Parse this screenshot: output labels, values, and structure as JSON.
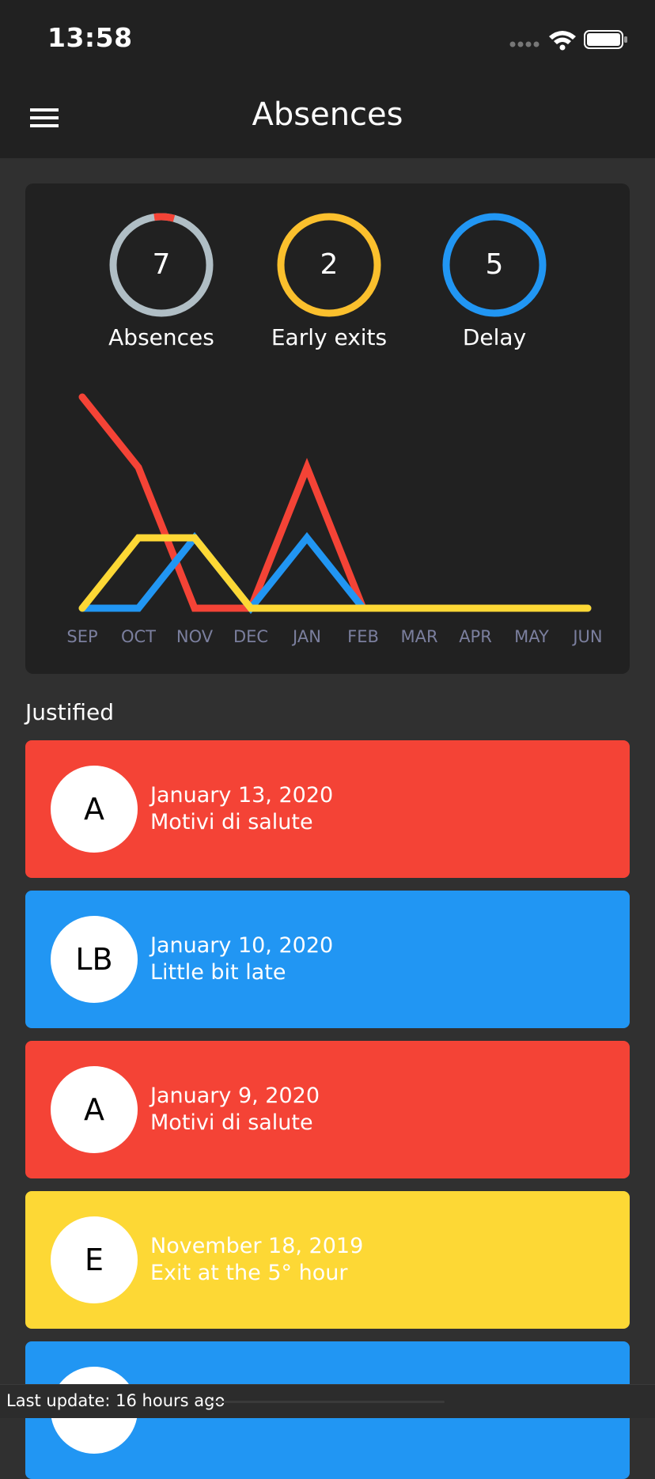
{
  "status_bar": {
    "time": "13:58"
  },
  "app_bar": {
    "title": "Absences"
  },
  "summary": {
    "absences": {
      "count": "7",
      "label": "Absences",
      "color": "#b0bec5",
      "accent": "#f44336"
    },
    "early_exits": {
      "count": "2",
      "label": "Early exits",
      "color": "#fbc02d"
    },
    "delay": {
      "count": "5",
      "label": "Delay",
      "color": "#2196f3"
    }
  },
  "chart_data": {
    "type": "line",
    "categories": [
      "SEP",
      "OCT",
      "NOV",
      "DEC",
      "JAN",
      "FEB",
      "MAR",
      "APR",
      "MAY",
      "JUN"
    ],
    "series": [
      {
        "color": "#f44336",
        "values": [
          3,
          2,
          0,
          0,
          2,
          0,
          0,
          0,
          0,
          0
        ]
      },
      {
        "color": "#2196f3",
        "values": [
          0,
          0,
          1,
          0,
          1,
          0,
          0,
          0,
          0,
          0
        ]
      },
      {
        "color": "#fdd835",
        "values": [
          0,
          1,
          1,
          0,
          0,
          0,
          0,
          0,
          0,
          0
        ]
      }
    ],
    "ylim": [
      0,
      3
    ]
  },
  "section": {
    "title": "Justified"
  },
  "items": [
    {
      "initials": "A",
      "date": "January 13, 2020",
      "reason": "Motivi di salute",
      "color": "#f44336"
    },
    {
      "initials": "LB",
      "date": "January 10, 2020",
      "reason": "Little bit late",
      "color": "#2196f3"
    },
    {
      "initials": "A",
      "date": "January 9, 2020",
      "reason": "Motivi di salute",
      "color": "#f44336"
    },
    {
      "initials": "E",
      "date": "November 18, 2019",
      "reason": "Exit at the 5° hour",
      "color": "#fdd835"
    }
  ],
  "footer": {
    "last_update": "Last update: 16 hours ago"
  }
}
